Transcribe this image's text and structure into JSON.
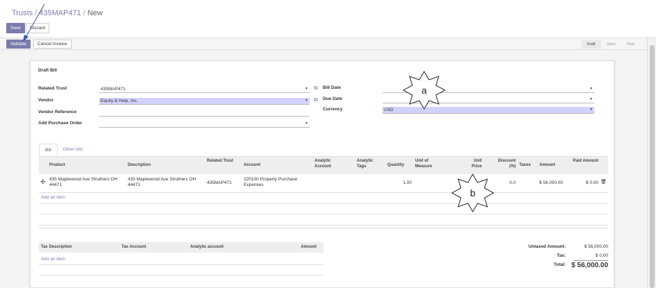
{
  "breadcrumb": {
    "root": "Trusts",
    "record": "435MAP471",
    "current": "New",
    "sep": "/"
  },
  "header": {
    "save_label": "Save",
    "discard_label": "Discard"
  },
  "statusbar": {
    "validate_label": "Validate",
    "cancel_label": "Cancel Invoice",
    "steps": [
      "Draft",
      "Open",
      "Paid"
    ],
    "active_step": "Draft"
  },
  "form": {
    "title": "Draft Bill",
    "related_trust": {
      "label": "Related Trust",
      "value": "435MAP471"
    },
    "vendor": {
      "label": "Vendor",
      "value": "Equity & Help, Inc."
    },
    "vendor_reference": {
      "label": "Vendor Reference",
      "value": ""
    },
    "add_purchase_order": {
      "label": "Add Purchase Order",
      "value": ""
    },
    "bill_date": {
      "label": "Bill Date",
      "value": ""
    },
    "due_date": {
      "label": "Due Date",
      "value": ""
    },
    "currency": {
      "label": "Currency",
      "value": "USD"
    }
  },
  "tabs": [
    "Bill",
    "Other Info"
  ],
  "lines": {
    "columns": [
      "Product",
      "Description",
      "Related Trust",
      "Account",
      "Analytic Account",
      "Analytic Tags",
      "Quantity",
      "Unit of Measure",
      "Unit Price",
      "Discount (%)",
      "Taxes",
      "Amount",
      "Paid Amount"
    ],
    "rows": [
      {
        "product": "435 Maplewood Ave Struthers OH 44471",
        "description": "435 Maplewood Ave Struthers OH 44471",
        "related_trust": "435MAP471",
        "account": "220100 Property Purchase Expenses",
        "analytic_account": "",
        "analytic_tags": "",
        "quantity": "1.00",
        "uom": "",
        "unit_price": "",
        "discount": "0.0",
        "taxes": "",
        "amount": "$ 56,000.00",
        "paid_amount": "$ 0.00"
      }
    ],
    "add_item": "Add an item"
  },
  "taxes": {
    "columns": [
      "Tax Description",
      "Tax Account",
      "Analytic account",
      "Amount"
    ],
    "add_item": "Add an item"
  },
  "totals": {
    "untaxed_label": "Untaxed Amount:",
    "untaxed_value": "$ 56,000.00",
    "tax_label": "Tax:",
    "tax_value": "$ 0.00",
    "total_label": "Total:",
    "total_value": "$ 56,000.00"
  },
  "annotations": {
    "a": "a",
    "b": "b"
  },
  "colors": {
    "accent": "#7c7bad",
    "highlight": "#d2d2ff"
  }
}
